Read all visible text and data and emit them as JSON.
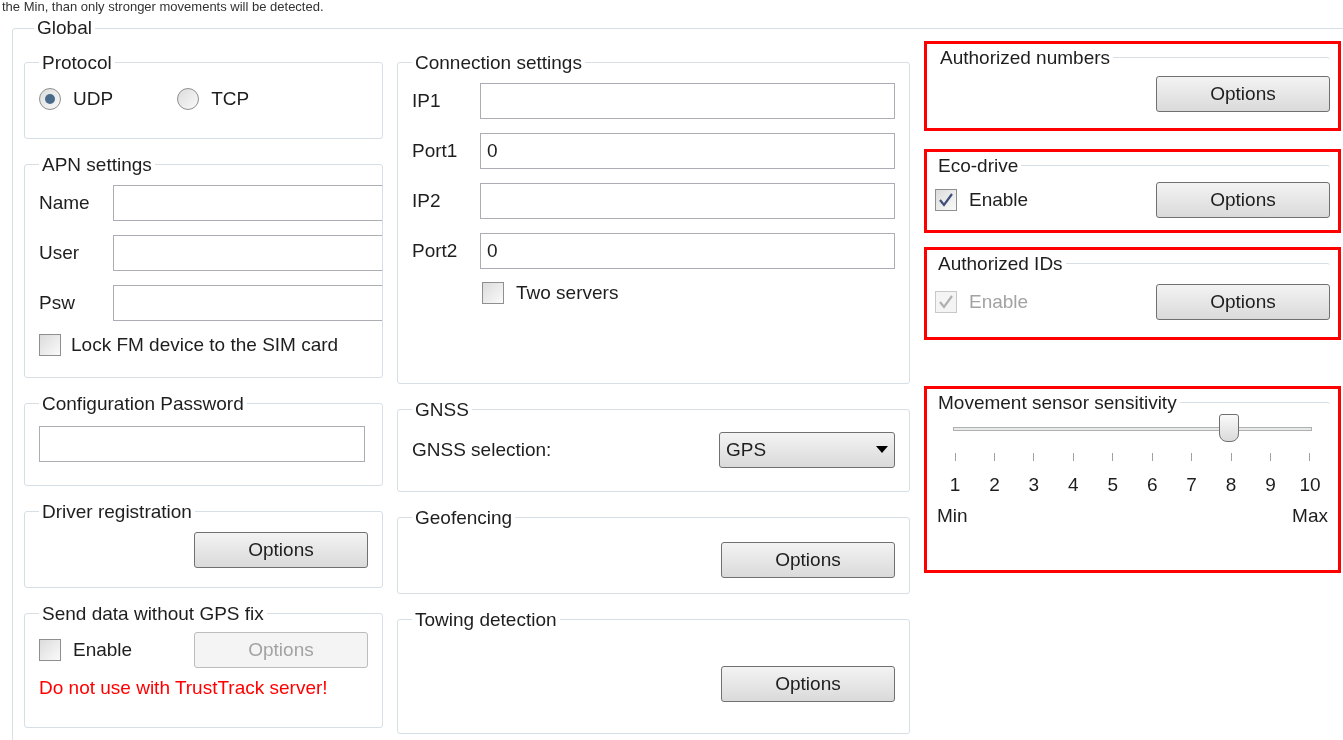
{
  "caption_above": "the Min, than only stronger movements will be detected.",
  "global": {
    "title": "Global",
    "protocol": {
      "title": "Protocol",
      "options": [
        {
          "label": "UDP",
          "selected": true
        },
        {
          "label": "TCP",
          "selected": false
        }
      ]
    },
    "apn_settings": {
      "title": "APN settings",
      "fields": [
        {
          "label": "Name"
        },
        {
          "label": "User"
        },
        {
          "label": "Psw"
        }
      ],
      "lock": {
        "label": "Lock FM device to the SIM card",
        "checked": false
      }
    },
    "configuration_password": {
      "title": "Configuration Password"
    },
    "driver_registration": {
      "title": "Driver registration",
      "button": {
        "label": "Options",
        "disabled": false
      }
    },
    "send_data_without_gps_fix": {
      "title": "Send data without GPS fix",
      "enable": {
        "label": "Enable",
        "checked": false
      },
      "button": {
        "label": "Options",
        "disabled": true
      },
      "warning": "Do not use with TrustTrack server!"
    },
    "connection_settings": {
      "title": "Connection settings",
      "fields": [
        {
          "label": "IP1"
        },
        {
          "label": "Port1",
          "value": "0"
        },
        {
          "label": "IP2"
        },
        {
          "label": "Port2",
          "value": "0"
        }
      ],
      "two_servers": {
        "label": "Two servers",
        "checked": false
      }
    },
    "gnss": {
      "title": "GNSS",
      "label": "GNSS selection:",
      "value": "GPS"
    },
    "geofencing": {
      "title": "Geofencing",
      "button": {
        "label": "Options",
        "disabled": false
      }
    },
    "towing_detection": {
      "title": "Towing detection",
      "button": {
        "label": "Options",
        "disabled": false
      }
    },
    "authorized_numbers": {
      "title": "Authorized numbers",
      "highlighted": true,
      "button": {
        "label": "Options",
        "disabled": false
      }
    },
    "eco_drive": {
      "title": "Eco-drive",
      "highlighted": true,
      "enable": {
        "label": "Enable",
        "checked": true,
        "disabled": false
      },
      "button": {
        "label": "Options",
        "disabled": false
      }
    },
    "authorized_ids": {
      "title": "Authorized IDs",
      "highlighted": true,
      "enable": {
        "label": "Enable",
        "checked": true,
        "disabled": true
      },
      "button": {
        "label": "Options",
        "disabled": false
      }
    },
    "movement_sensor_sensitivity": {
      "title": "Movement sensor sensitivity",
      "highlighted": true,
      "ticks": [
        "1",
        "2",
        "3",
        "4",
        "5",
        "6",
        "7",
        "8",
        "9",
        "10"
      ],
      "min_label": "Min",
      "max_label": "Max",
      "level": 0.77
    }
  }
}
